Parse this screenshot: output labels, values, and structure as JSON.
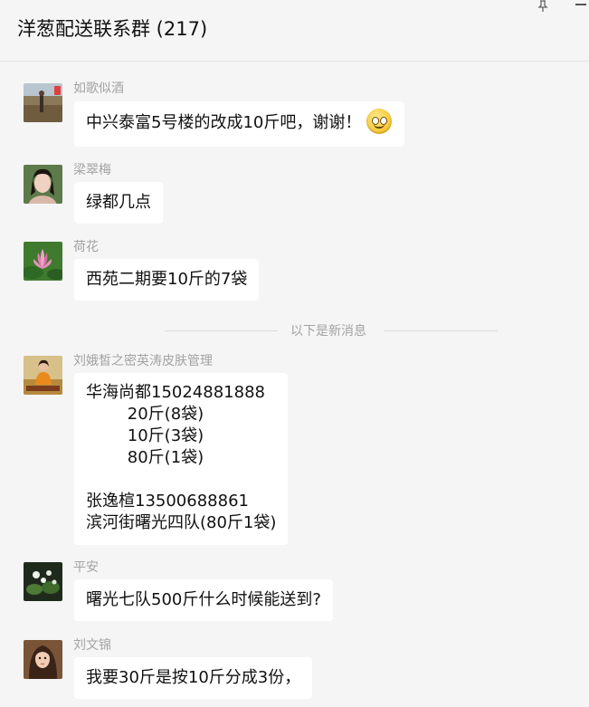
{
  "header": {
    "title": "洋葱配送联系群 (217)"
  },
  "divider": {
    "label": "以下是新消息"
  },
  "messages": [
    {
      "sender": "如歌似酒",
      "text": "中兴泰富5号楼的改成10斤吧，谢谢！",
      "emoji": "smile-emoji-icon"
    },
    {
      "sender": "梁翠梅",
      "text": "绿都几点"
    },
    {
      "sender": "荷花",
      "text": "西苑二期要10斤的7袋"
    },
    {
      "sender": "刘娥皙之密英涛皮肤管理",
      "lines": [
        "华海尚都15024881888",
        "        20斤(8袋)",
        "        10斤(3袋)",
        "        80斤(1袋)",
        "",
        "张逸楦13500688861",
        "滨河街曙光四队(80斤1袋)"
      ]
    },
    {
      "sender": "平安",
      "text": "曙光七队500斤什么时候能送到?"
    },
    {
      "sender": "刘文锦",
      "text": "我要30斤是按10斤分成3份，"
    }
  ],
  "colors": {
    "background": "#f5f5f5",
    "bubble": "#ffffff",
    "sender_text": "#a3a3a3"
  }
}
